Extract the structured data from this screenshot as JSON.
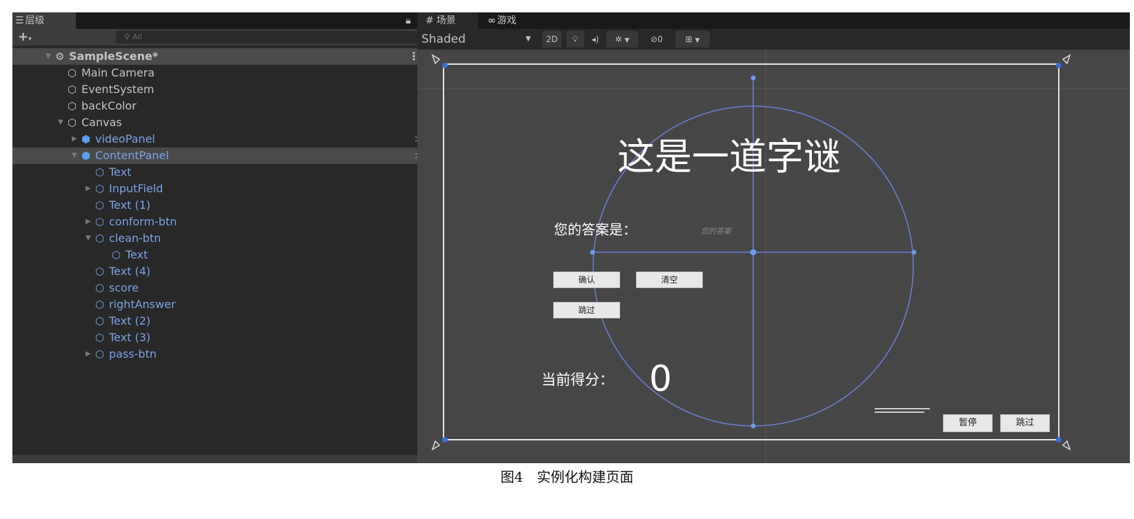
{
  "hierarchy": {
    "tab_label": "层级",
    "search_placeholder": "All",
    "items": [
      {
        "label": "SampleScene*",
        "expanded": true
      },
      {
        "label": "Main Camera"
      },
      {
        "label": "EventSystem"
      },
      {
        "label": "backColor"
      },
      {
        "label": "Canvas",
        "expanded": true
      },
      {
        "label": "videoPanel",
        "collapsed": true
      },
      {
        "label": "ContentPanel",
        "expanded": true
      },
      {
        "label": "Text"
      },
      {
        "label": "InputField",
        "collapsed": true
      },
      {
        "label": "Text (1)"
      },
      {
        "label": "conform-btn",
        "collapsed": true
      },
      {
        "label": "clean-btn",
        "expanded": true
      },
      {
        "label": "Text"
      },
      {
        "label": "Text (4)"
      },
      {
        "label": "score"
      },
      {
        "label": "rightAnswer"
      },
      {
        "label": "Text (2)"
      },
      {
        "label": "Text (3)"
      },
      {
        "label": "pass-btn",
        "collapsed": true
      }
    ]
  },
  "scene": {
    "tabs": [
      {
        "label": "场景",
        "icon": "grid-icon"
      },
      {
        "label": "游戏",
        "icon": "gamepad-icon"
      }
    ],
    "shading_mode": "Shaded",
    "toolbar": {
      "mode_2d": "2D",
      "hidden_count": "0"
    }
  },
  "game_ui": {
    "title": "这是一道字谜",
    "answer_label": "您的答案是：",
    "answer_placeholder": "您的答案",
    "confirm_button": "确认",
    "clear_button": "清空",
    "skip_button": "跳过",
    "score_label": "当前得分：",
    "score_value": "0",
    "pause_button_bottom": "暂停",
    "skip_button_bottom": "跳过"
  },
  "caption": "图4　实例化构建页面",
  "colors": {
    "panel_bg": "#282828",
    "scene_bg": "#464646",
    "selection": "#4a4a4a",
    "prefab_blue": "#7ba4e8",
    "gizmo_blue": "#6a7fd8"
  }
}
